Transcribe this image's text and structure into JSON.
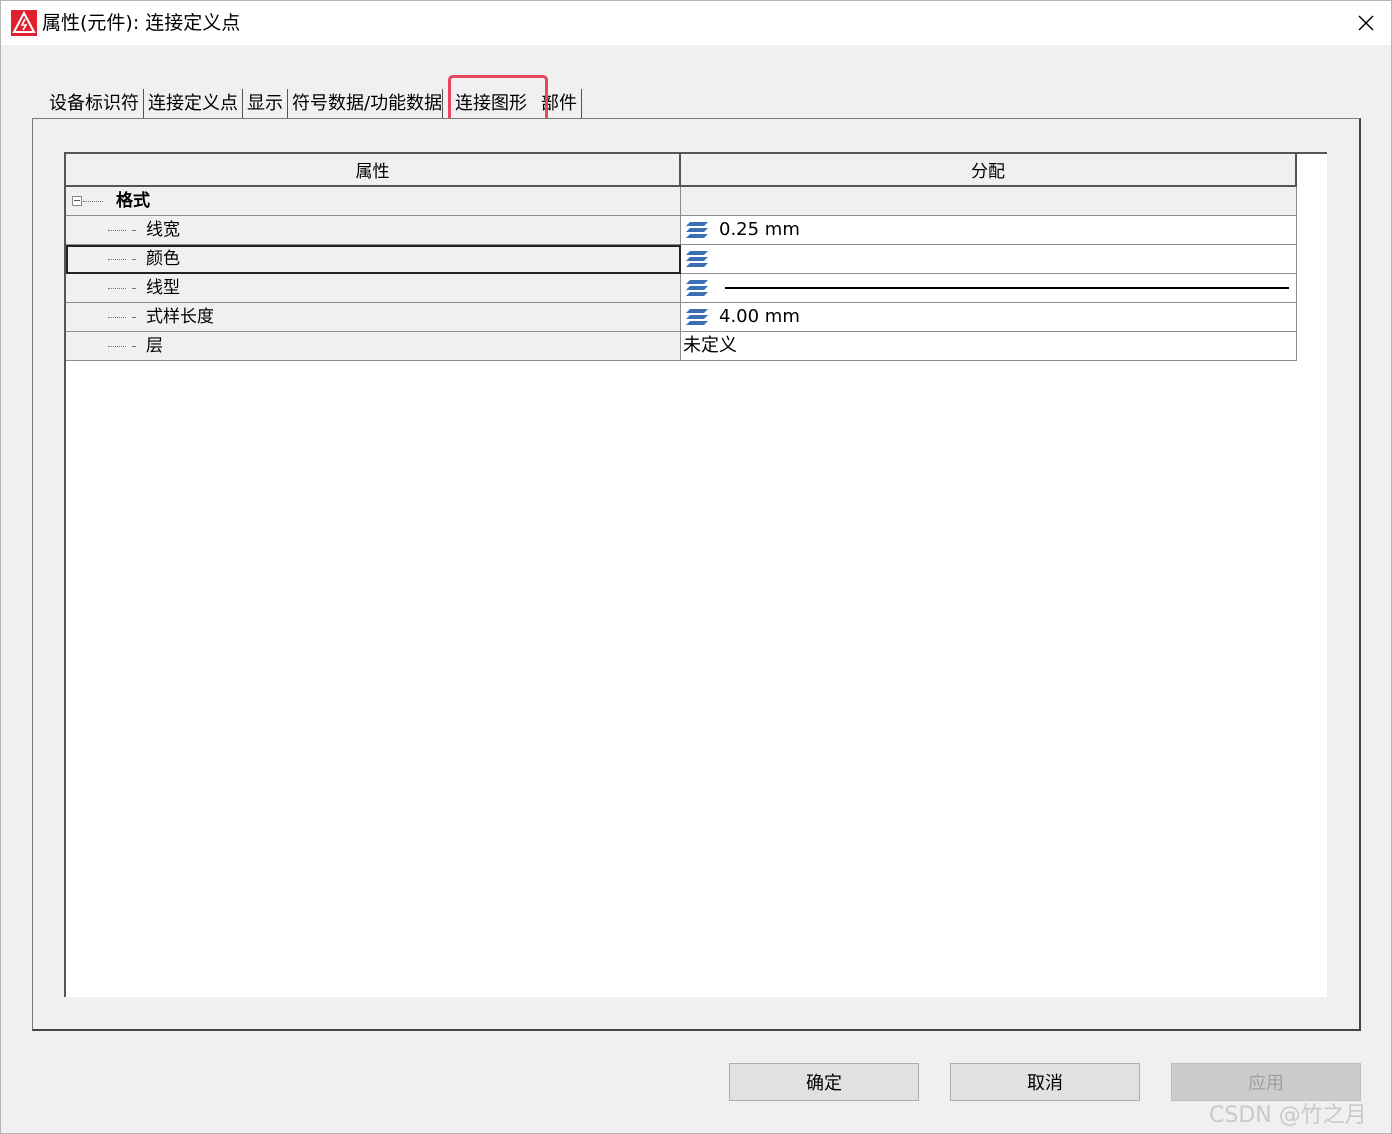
{
  "window": {
    "title": "属性(元件): 连接定义点",
    "accent_color": "#e0202e"
  },
  "tabs": [
    {
      "label": "设备标识符"
    },
    {
      "label": "连接定义点"
    },
    {
      "label": "显示"
    },
    {
      "label": "符号数据/功能数据"
    },
    {
      "label": "连接图形",
      "active": true,
      "highlight_color": "#e8455e"
    },
    {
      "label": "部件"
    }
  ],
  "grid": {
    "columns": [
      "属性",
      "分配"
    ],
    "rows": [
      {
        "name": "格式",
        "value": "",
        "group": true
      },
      {
        "name": "线宽",
        "value": "0.25 mm",
        "icon": "layer-icon"
      },
      {
        "name": "颜色",
        "value": "",
        "icon": "layer-icon",
        "selected": true
      },
      {
        "name": "线型",
        "value": "",
        "icon": "layer-icon",
        "line_sample": "solid"
      },
      {
        "name": "式样长度",
        "value": "4.00 mm",
        "icon": "layer-icon"
      },
      {
        "name": "层",
        "value": "未定义"
      }
    ]
  },
  "buttons": {
    "ok": "确定",
    "cancel": "取消",
    "apply": "应用"
  },
  "watermark": "CSDN @竹之月"
}
